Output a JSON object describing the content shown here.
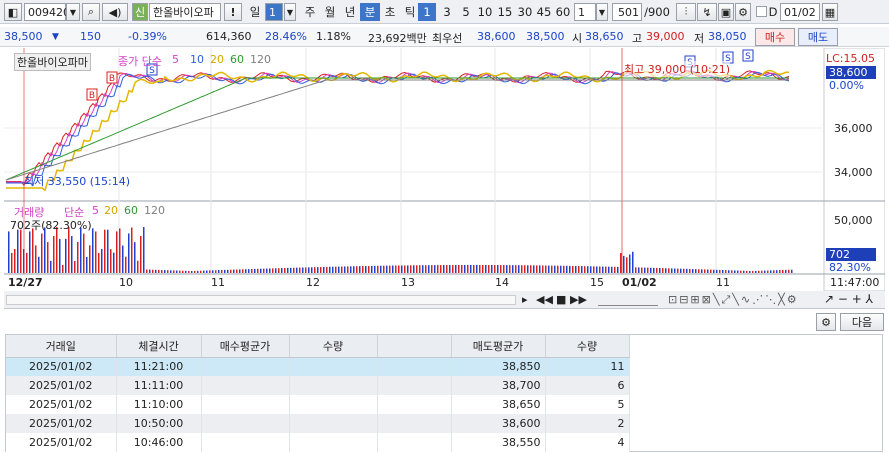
{
  "toolbar": {
    "code": "009420",
    "name": "한올바이오파",
    "credit_badge": "신",
    "warn": "!",
    "period_selected": "일",
    "period_num": "1",
    "periods": [
      "주",
      "월",
      "년",
      "분",
      "초",
      "틱"
    ],
    "min_buttons": [
      "1",
      "3",
      "5",
      "10",
      "15",
      "30",
      "45",
      "60"
    ],
    "min_custom": "1",
    "count": "501",
    "count_max": "/900",
    "date": "01/02",
    "d_label": "D"
  },
  "quote": {
    "price": "38,500",
    "arrow": "▼",
    "change": "150",
    "change_pct": "-0.39%",
    "volume": "614,360",
    "turnover_pct": "28.46%",
    "rate": "1.18%",
    "amount": "23,692백만",
    "best_label": "최우선",
    "best_ask": "38,600",
    "best_bid": "38,500",
    "open_label": "시",
    "open": "38,650",
    "high_label": "고",
    "high": "39,000",
    "low_label": "저",
    "low": "38,050",
    "buy": "매수",
    "sell": "매도"
  },
  "chart": {
    "title": "한올바이오파마",
    "ma_label": "종가 단순",
    "ma_periods": [
      "5",
      "10",
      "20",
      "60",
      "120"
    ],
    "low_note": "최저 33,550 (15:14)",
    "high_note": "최고 39,000 (10:21)",
    "lc": "LC:15.05",
    "cur_price": "38,600",
    "cur_pct": "0.00%",
    "y_labels": [
      "36,000",
      "34,000"
    ],
    "vol_title": "거래량",
    "vol_ma_label": "단순",
    "vol_ma_periods": [
      "5",
      "20",
      "60",
      "120"
    ],
    "vol_note": "702주(82.30%)",
    "vol_y": "50,000",
    "vol_cur": "702",
    "vol_cur_pct": "82.30%",
    "x_labels": [
      "12/27",
      "10",
      "11",
      "12",
      "13",
      "14",
      "15",
      "01/02",
      "11"
    ],
    "time_right": "11:47:00",
    "colors": {
      "ma5": "#d640c8",
      "ma10": "#2f5fd8",
      "ma20": "#e3b800",
      "ma60": "#2e9a2e",
      "ma120": "#808080",
      "up": "#d82020",
      "down": "#2040d0"
    }
  },
  "panel": {
    "next": "다음"
  },
  "table": {
    "headers": [
      "거래일",
      "체결시간",
      "매수평균가",
      "수량",
      "",
      "매도평균가",
      "수량"
    ],
    "rows": [
      [
        "2025/01/02",
        "11:21:00",
        "",
        "",
        "",
        "38,850",
        "11"
      ],
      [
        "2025/01/02",
        "11:11:00",
        "",
        "",
        "",
        "38,700",
        "6"
      ],
      [
        "2025/01/02",
        "11:10:00",
        "",
        "",
        "",
        "38,650",
        "5"
      ],
      [
        "2025/01/02",
        "10:50:00",
        "",
        "",
        "",
        "38,600",
        "2"
      ],
      [
        "2025/01/02",
        "10:46:00",
        "",
        "",
        "",
        "38,550",
        "4"
      ]
    ]
  }
}
